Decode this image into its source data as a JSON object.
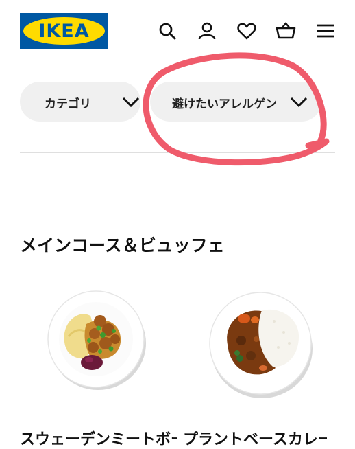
{
  "header": {
    "logo_text": "IKEA",
    "icons": [
      "search-icon",
      "account-icon",
      "heart-icon",
      "basket-icon",
      "hamburger-menu-icon"
    ],
    "brand_blue": "#0058a3",
    "brand_yellow": "#ffdb00"
  },
  "filters": [
    {
      "label": "カテゴリ"
    },
    {
      "label": "避けたいアレルゲン"
    }
  ],
  "annotation": {
    "color": "#ef5b6b"
  },
  "section": {
    "title": "メインコース＆ビュッフェ"
  },
  "products": [
    {
      "name": "スウェーデンミートボール"
    },
    {
      "name": "プラントベースカレー"
    }
  ]
}
